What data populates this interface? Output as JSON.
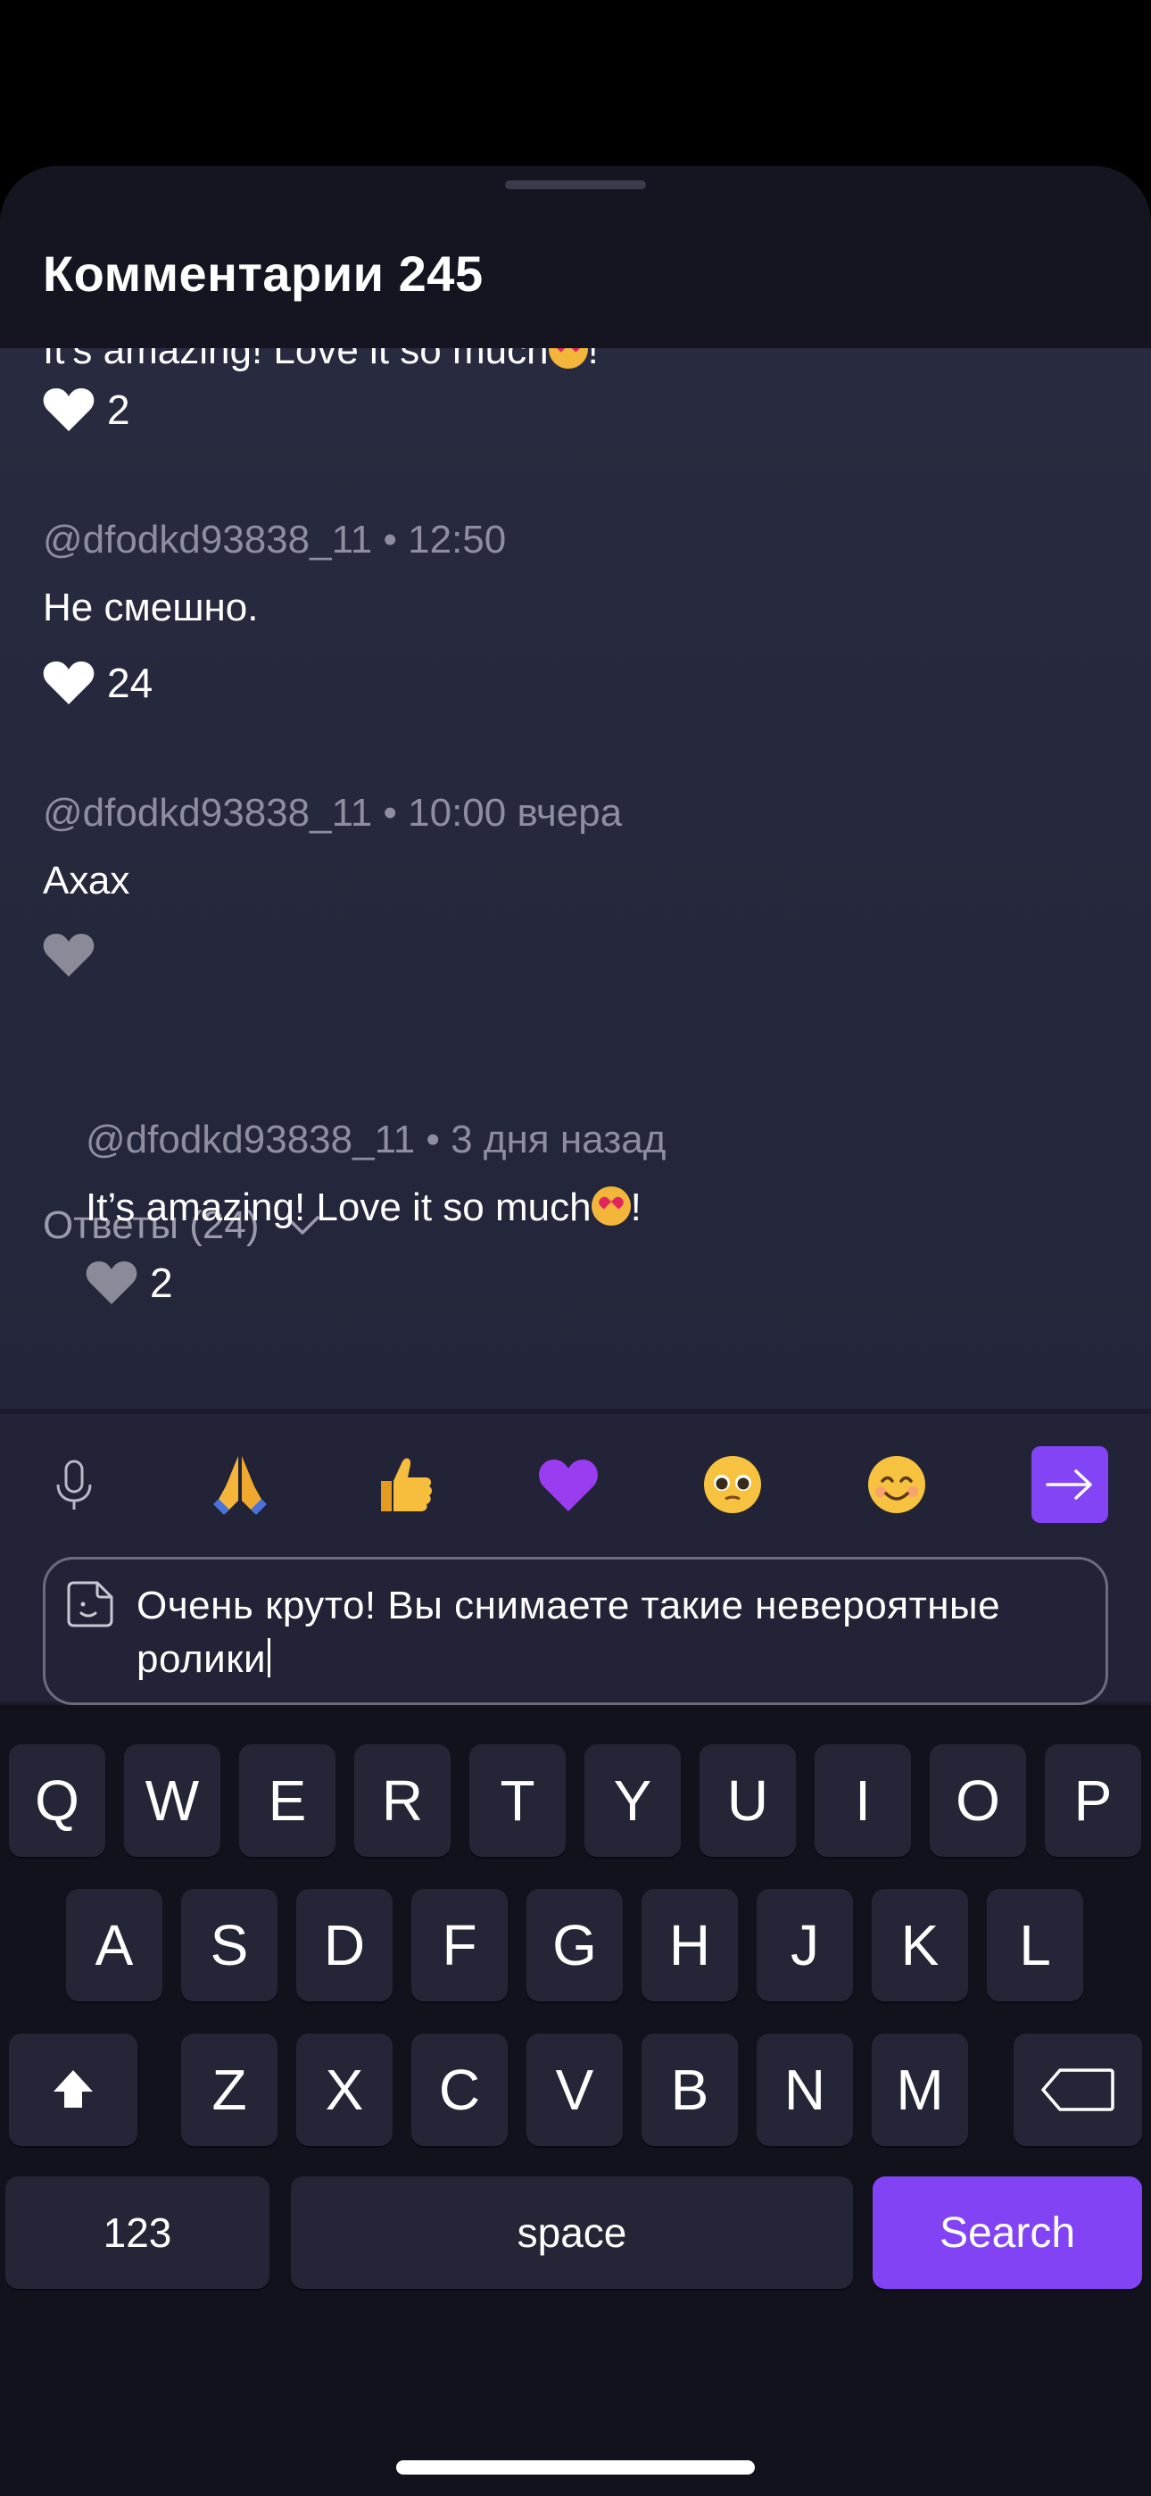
{
  "sheet": {
    "title": "Комментарии 245"
  },
  "comments": {
    "partial_top": {
      "text": "It’s amazing! Love it so much",
      "text_end": "!",
      "likes": "2"
    },
    "items": [
      {
        "meta": "@dfodkd93838_11 • 12:50",
        "text": "Не смешно.",
        "likes": "24",
        "liked": true
      },
      {
        "meta": "@dfodkd93838_11 • 10:00 вчера",
        "text": "Ахах",
        "likes": "",
        "liked": false
      }
    ],
    "replies_toggle": "Ответы (24)",
    "reply": {
      "meta": "@dfodkd93838_11 • 3 дня назад",
      "text": "It’s amazing! Love it so much",
      "text_end": "!",
      "likes": "2"
    }
  },
  "composer": {
    "quick_reactions": [
      "microphone-icon",
      "folded-hands-emoji",
      "thumbs-up-emoji",
      "purple-heart-emoji",
      "pleading-face-emoji",
      "smiling-face-emoji"
    ],
    "input_value": "Очень круто! Вы снимаете такие невероятные\nролики"
  },
  "keyboard": {
    "row1": [
      "Q",
      "W",
      "E",
      "R",
      "T",
      "Y",
      "U",
      "I",
      "O",
      "P"
    ],
    "row2": [
      "A",
      "S",
      "D",
      "F",
      "G",
      "H",
      "J",
      "K",
      "L"
    ],
    "row3": [
      "Z",
      "X",
      "C",
      "V",
      "B",
      "N",
      "M"
    ],
    "numbers_label": "123",
    "space_label": "space",
    "search_label": "Search"
  },
  "colors": {
    "accent": "#8244f4",
    "sheet_bg": "#1b1b2b",
    "comment_bg": "#282a3f",
    "keyboard_bg": "#12121d",
    "key_bg": "#242637",
    "muted_text": "#8e8ea0"
  }
}
